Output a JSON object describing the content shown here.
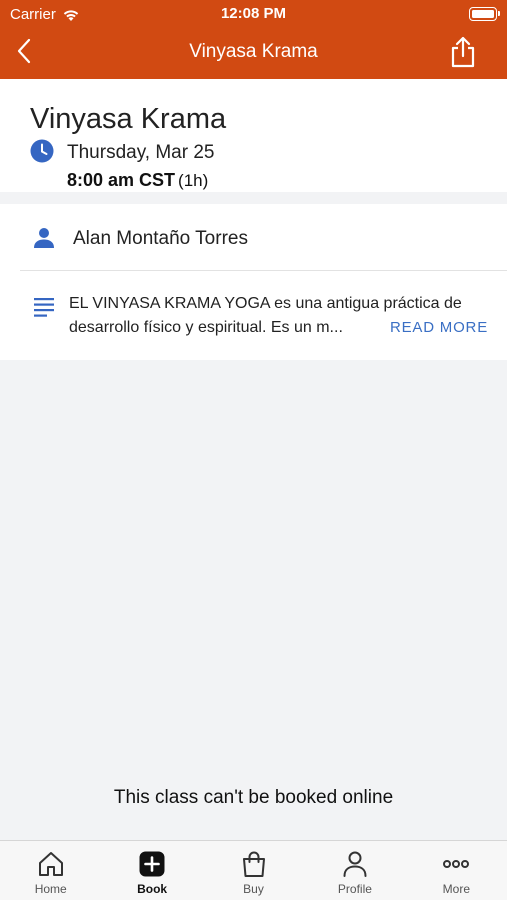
{
  "status_bar": {
    "carrier": "Carrier",
    "time": "12:08 PM",
    "battery_level": 1.0
  },
  "nav": {
    "title": "Vinyasa Krama",
    "back_icon": "chevron-left-icon",
    "share_icon": "share-icon"
  },
  "class": {
    "title": "Vinyasa Krama",
    "date": "Thursday, Mar 25",
    "time": "8:00 am CST",
    "duration": "(1h)",
    "instructor": "Alan Montaño Torres",
    "description_line1": "EL VINYASA KRAMA YOGA es una antigua práctica de",
    "description_line2": "desarrollo físico y espiritual. Es un m...",
    "read_more": "READ MORE"
  },
  "booking_note": "This class can't be booked online",
  "tabs": [
    {
      "label": "Home",
      "icon": "home-icon",
      "active": false
    },
    {
      "label": "Book",
      "icon": "plus-square-icon",
      "active": true
    },
    {
      "label": "Buy",
      "icon": "shopping-bag-icon",
      "active": false
    },
    {
      "label": "Profile",
      "icon": "person-icon",
      "active": false
    },
    {
      "label": "More",
      "icon": "more-dots-icon",
      "active": false
    }
  ],
  "colors": {
    "header": "#d14a12",
    "accent_blue": "#3a6fc4",
    "icon_blue": "#3566c2"
  }
}
